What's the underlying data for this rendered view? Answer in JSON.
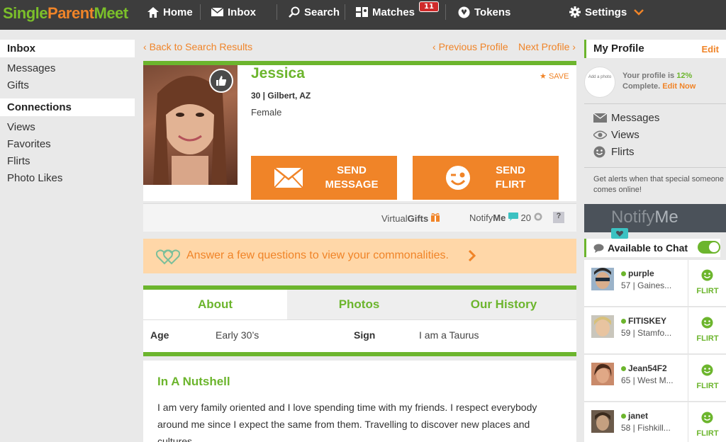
{
  "brand": {
    "single": "Single",
    "parent": "Parent",
    "meet": "Meet"
  },
  "nav": {
    "home": "Home",
    "inbox": "Inbox",
    "search": "Search",
    "matches": "Matches",
    "matches_badge": "11",
    "tokens": "Tokens",
    "settings": "Settings"
  },
  "left": {
    "inbox_head": "Inbox",
    "messages": "Messages",
    "gifts": "Gifts",
    "connections_head": "Connections",
    "views": "Views",
    "favorites": "Favorites",
    "flirts": "Flirts",
    "photo_likes": "Photo Likes"
  },
  "center": {
    "back": "Back to Search Results",
    "prev": "Previous Profile",
    "next": "Next Profile",
    "profile": {
      "name": "Jessica",
      "age_location": "30 | Gilbert, AZ",
      "gender": "Female",
      "save": "SAVE"
    },
    "send_message": {
      "l1": "SEND",
      "l2": "MESSAGE"
    },
    "send_flirt": {
      "l1": "SEND",
      "l2": "FLIRT"
    },
    "virtual_gifts": {
      "a": "Virtual",
      "b": "Gifts"
    },
    "notify": {
      "a": "Notify",
      "b": "Me",
      "count": "20",
      "help": "?"
    },
    "commonalities": "Answer a few questions to view your commonalities.",
    "tabs": [
      "About",
      "Photos",
      "Our History"
    ],
    "about": {
      "age_label": "Age",
      "age_value": "Early 30’s",
      "sign_label": "Sign",
      "sign_value": "I am a Taurus"
    },
    "nutshell": {
      "title": "In A Nutshell",
      "text": "I am very family oriented and I love spending time with my friends. I respect everybody around me since I expect the same from them. Travelling to discover new places and cultures."
    }
  },
  "right": {
    "my_profile": "My Profile",
    "edit": "Edit",
    "add_photo": "Add a photo",
    "complete_pre": "Your profile is ",
    "complete_pct": "12%",
    "complete_post": "Complete.",
    "edit_now": "Edit Now",
    "messages": "Messages",
    "views": "Views",
    "flirts": "Flirts",
    "alerts": "Get alerts when that special someone comes online!",
    "notify_banner": {
      "a": "Notify",
      "b": "Me"
    },
    "chat_head": "Available to Chat",
    "chat_users": [
      {
        "name": "purple",
        "loc": "57 | Gaines...",
        "flirt": "FLIRT"
      },
      {
        "name": "FITISKEY",
        "loc": "59 | Stamfo...",
        "flirt": "FLIRT"
      },
      {
        "name": "Jean54F2",
        "loc": "65 | West M...",
        "flirt": "FLIRT"
      },
      {
        "name": "janet",
        "loc": "58 | Fishkill...",
        "flirt": "FLIRT"
      }
    ]
  },
  "colors": {
    "accent_green": "#6cb52d",
    "accent_orange": "#f08428",
    "nav_bg": "#3d3d3d"
  }
}
